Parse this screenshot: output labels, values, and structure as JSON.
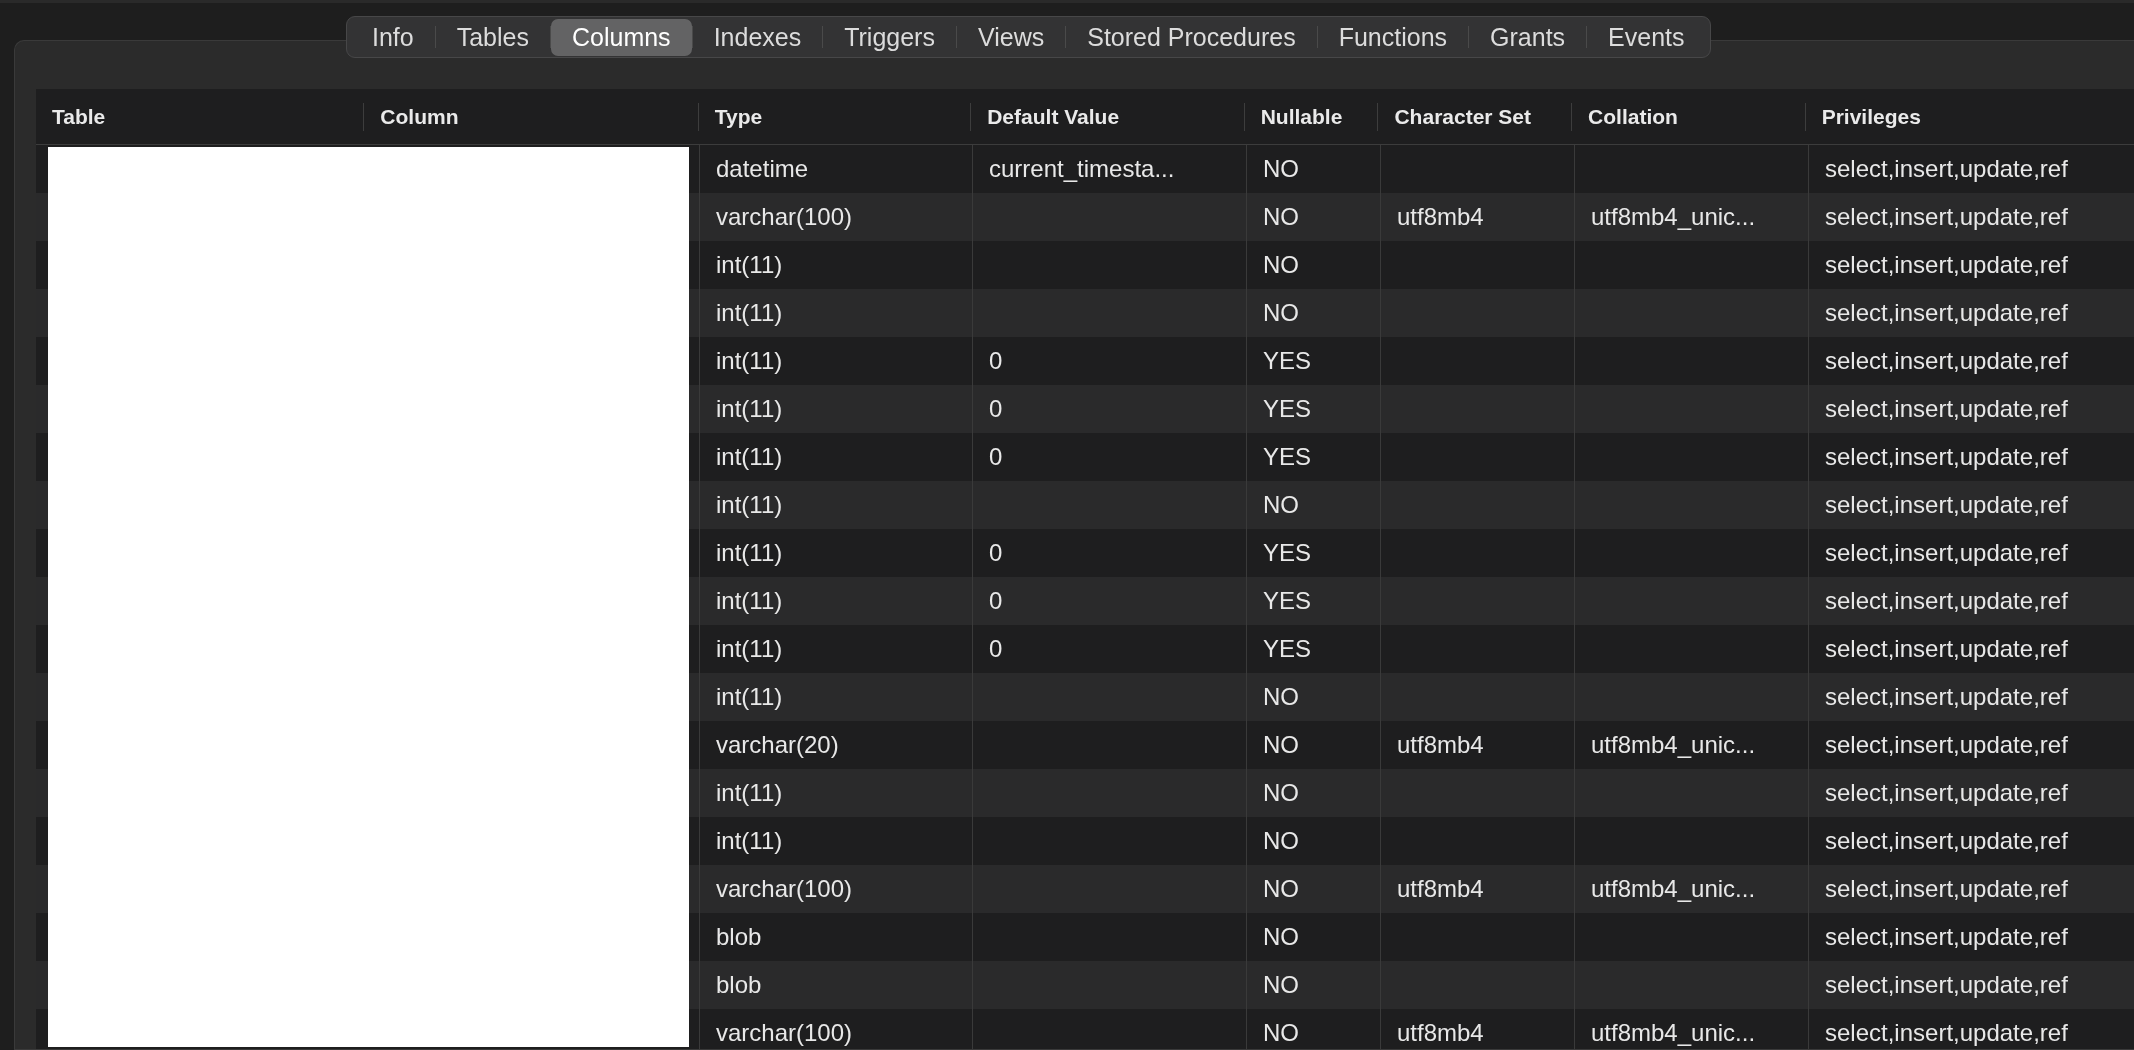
{
  "tabs": [
    {
      "label": "Info",
      "selected": false
    },
    {
      "label": "Tables",
      "selected": false
    },
    {
      "label": "Columns",
      "selected": true
    },
    {
      "label": "Indexes",
      "selected": false
    },
    {
      "label": "Triggers",
      "selected": false
    },
    {
      "label": "Views",
      "selected": false
    },
    {
      "label": "Stored Procedures",
      "selected": false
    },
    {
      "label": "Functions",
      "selected": false
    },
    {
      "label": "Grants",
      "selected": false
    },
    {
      "label": "Events",
      "selected": false
    }
  ],
  "table": {
    "columns": [
      "Table",
      "Column",
      "Type",
      "Default Value",
      "Nullable",
      "Character Set",
      "Collation",
      "Privileges"
    ],
    "rows": [
      {
        "type": "datetime",
        "default": "current_timesta...",
        "nullable": "NO",
        "charset": "",
        "collation": "",
        "privileges": "select,insert,update,ref"
      },
      {
        "type": "varchar(100)",
        "default": "",
        "nullable": "NO",
        "charset": "utf8mb4",
        "collation": "utf8mb4_unic...",
        "privileges": "select,insert,update,ref"
      },
      {
        "type": "int(11)",
        "default": "",
        "nullable": "NO",
        "charset": "",
        "collation": "",
        "privileges": "select,insert,update,ref"
      },
      {
        "type": "int(11)",
        "default": "",
        "nullable": "NO",
        "charset": "",
        "collation": "",
        "privileges": "select,insert,update,ref"
      },
      {
        "type": "int(11)",
        "default": "0",
        "nullable": "YES",
        "charset": "",
        "collation": "",
        "privileges": "select,insert,update,ref"
      },
      {
        "type": "int(11)",
        "default": "0",
        "nullable": "YES",
        "charset": "",
        "collation": "",
        "privileges": "select,insert,update,ref"
      },
      {
        "type": "int(11)",
        "default": "0",
        "nullable": "YES",
        "charset": "",
        "collation": "",
        "privileges": "select,insert,update,ref"
      },
      {
        "type": "int(11)",
        "default": "",
        "nullable": "NO",
        "charset": "",
        "collation": "",
        "privileges": "select,insert,update,ref"
      },
      {
        "type": "int(11)",
        "default": "0",
        "nullable": "YES",
        "charset": "",
        "collation": "",
        "privileges": "select,insert,update,ref"
      },
      {
        "type": "int(11)",
        "default": "0",
        "nullable": "YES",
        "charset": "",
        "collation": "",
        "privileges": "select,insert,update,ref"
      },
      {
        "type": "int(11)",
        "default": "0",
        "nullable": "YES",
        "charset": "",
        "collation": "",
        "privileges": "select,insert,update,ref"
      },
      {
        "type": "int(11)",
        "default": "",
        "nullable": "NO",
        "charset": "",
        "collation": "",
        "privileges": "select,insert,update,ref"
      },
      {
        "type": "varchar(20)",
        "default": "",
        "nullable": "NO",
        "charset": "utf8mb4",
        "collation": "utf8mb4_unic...",
        "privileges": "select,insert,update,ref"
      },
      {
        "type": "int(11)",
        "default": "",
        "nullable": "NO",
        "charset": "",
        "collation": "",
        "privileges": "select,insert,update,ref"
      },
      {
        "type": "int(11)",
        "default": "",
        "nullable": "NO",
        "charset": "",
        "collation": "",
        "privileges": "select,insert,update,ref"
      },
      {
        "type": "varchar(100)",
        "default": "",
        "nullable": "NO",
        "charset": "utf8mb4",
        "collation": "utf8mb4_unic...",
        "privileges": "select,insert,update,ref"
      },
      {
        "type": "blob",
        "default": "",
        "nullable": "NO",
        "charset": "",
        "collation": "",
        "privileges": "select,insert,update,ref"
      },
      {
        "type": "blob",
        "default": "",
        "nullable": "NO",
        "charset": "",
        "collation": "",
        "privileges": "select,insert,update,ref"
      },
      {
        "type": "varchar(100)",
        "default": "",
        "nullable": "NO",
        "charset": "utf8mb4",
        "collation": "utf8mb4_unic...",
        "privileges": "select,insert,update,ref"
      }
    ]
  }
}
